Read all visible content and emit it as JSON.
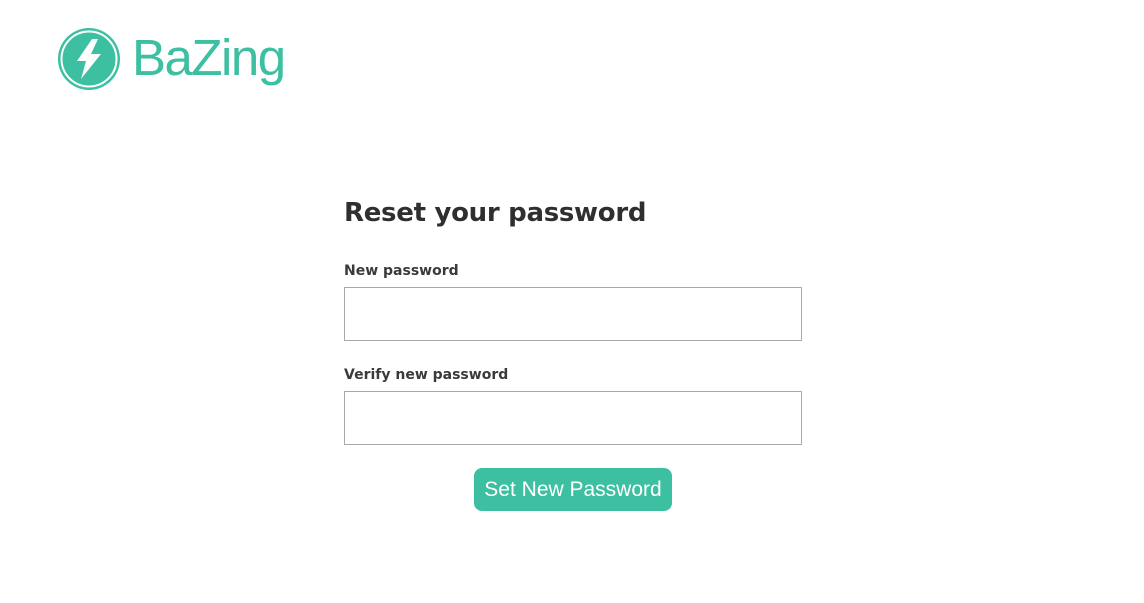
{
  "brand": {
    "name": "BaZing",
    "logo_icon": "lightning-bolt-icon",
    "accent_color": "#3dbfa1"
  },
  "form": {
    "title": "Reset your password",
    "new_password": {
      "label": "New password",
      "value": ""
    },
    "verify_password": {
      "label": "Verify new password",
      "value": ""
    },
    "submit_label": "Set New Password"
  }
}
